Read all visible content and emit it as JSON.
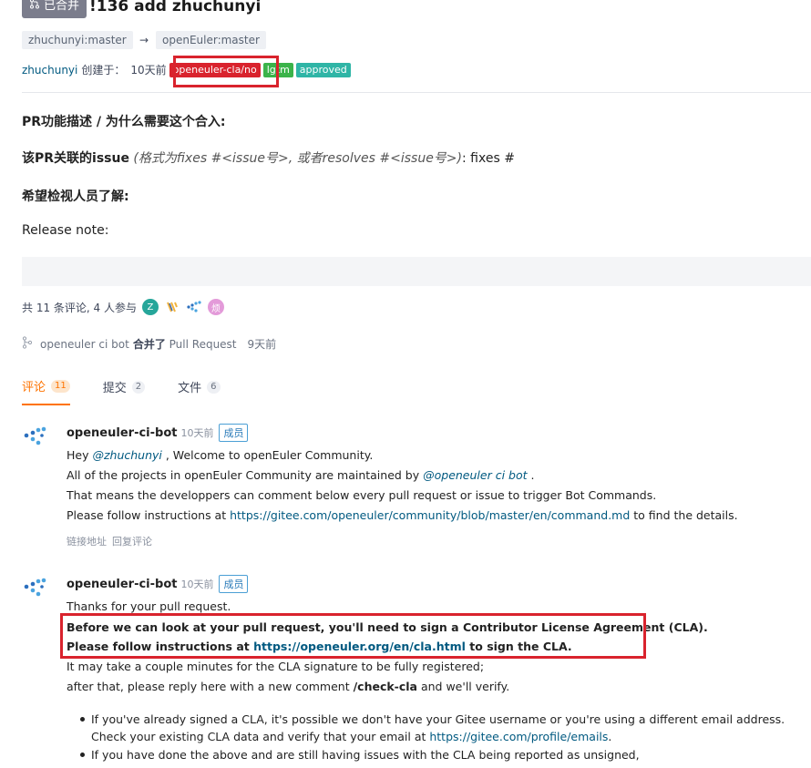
{
  "pr": {
    "state": "已合并",
    "title": "!136 add zhuchunyi",
    "source_branch": "zhuchunyi:master",
    "arrow": "→",
    "target_branch": "openEuler:master",
    "author": "zhuchunyi",
    "created_label": "创建于：",
    "created_time": "10天前",
    "labels": [
      {
        "text": "openeuler-cla/no",
        "color": "#d9232d"
      },
      {
        "text": "lgtm",
        "color": "#3bb34a"
      },
      {
        "text": "approved",
        "color": "#2fb5a6"
      }
    ]
  },
  "description": {
    "line1": "PR功能描述 / 为什么需要这个合入:",
    "line2_bold": "该PR关联的issue",
    "line2_italic": " (格式为fixes #<issue号>, 或者resolves #<issue号>)",
    "line2_rest": ": fixes #",
    "line3": "希望检视人员了解:",
    "line4": "Release note:"
  },
  "participants": {
    "text": "共 11 条评论, 4 人参与",
    "avatars": [
      {
        "char": "Z",
        "color": "#26a69a"
      },
      {
        "char": "",
        "color": "#f2b33d"
      },
      {
        "char": "",
        "color": "#3d7bd6"
      },
      {
        "char": "烦",
        "color": "#e39ad9"
      }
    ]
  },
  "merged_event": {
    "actor": "openeuler ci bot",
    "action": "合并了",
    "object": "Pull Request",
    "time": "9天前"
  },
  "tabs": [
    {
      "label": "评论",
      "count": "11"
    },
    {
      "label": "提交",
      "count": "2"
    },
    {
      "label": "文件",
      "count": "6"
    }
  ],
  "comment1": {
    "author": "openeuler-ci-bot",
    "time": "10天前",
    "role": "成员",
    "l1_pre": "Hey ",
    "l1_mention": "@zhuchunyi",
    "l1_post": " , Welcome to openEuler Community.",
    "l2_pre": "All of the projects in openEuler Community are maintained by ",
    "l2_mention": "@openeuler ci bot",
    "l2_post": " .",
    "l3": "That means the developpers can comment below every pull request or issue to trigger Bot Commands.",
    "l4_pre": "Please follow instructions at ",
    "l4_link": "https://gitee.com/openeuler/community/blob/master/en/command.md",
    "l4_post": " to find the details.",
    "action_link": "链接地址",
    "action_reply": "回复评论"
  },
  "comment2": {
    "author": "openeuler-ci-bot",
    "time": "10天前",
    "role": "成员",
    "l1": "Thanks for your pull request.",
    "l2": "Before we can look at your pull request, you'll need to sign a Contributor License Agreement (CLA).",
    "l3_pre": "Please follow instructions at ",
    "l3_link": "https://openeuler.org/en/cla.html",
    "l3_post": " to sign the CLA.",
    "l4": "It may take a couple minutes for the CLA signature to be fully registered;",
    "l5_pre": "after that, please reply here with a new comment ",
    "l5_cmd": "/check-cla",
    "l5_post": " and we'll verify.",
    "b1_l1": "If you've already signed a CLA, it's possible we don't have your Gitee username or you're using a different email address.",
    "b1_l2_pre": "Check your existing CLA data and verify that your email at ",
    "b1_l2_link": "https://gitee.com/profile/emails",
    "b1_l2_post": ".",
    "b2_l1": "If you have done the above and are still having issues with the CLA being reported as unsigned,"
  }
}
